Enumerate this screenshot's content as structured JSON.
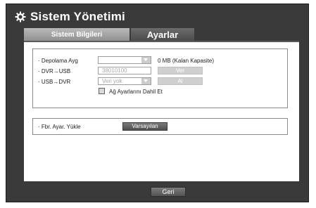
{
  "window": {
    "title": "Sistem Yönetimi",
    "title_icon": "gear-icon"
  },
  "tabs": [
    {
      "label": "Sistem Bilgileri",
      "active": false
    },
    {
      "label": "Ayarlar",
      "active": true
    }
  ],
  "settings": {
    "storage": {
      "label": "· Depolama Ayg",
      "value": "",
      "capacity_text": "0 MB (Kalan Kapasite)"
    },
    "dvr_to_usb": {
      "label": "· DVR→USB",
      "value": "38010100",
      "button_label": "Ver"
    },
    "usb_to_dvr": {
      "label": "· USB→DVR",
      "value": "Veri yok",
      "button_label": "Al"
    },
    "network_checkbox": {
      "label": "Ağ Ayarlarını Dahil Et",
      "checked": false
    }
  },
  "factory": {
    "label": "· Fbr. Ayar. Yükle",
    "button_label": "Varsayılan"
  },
  "footer": {
    "back_label": "Geri"
  }
}
